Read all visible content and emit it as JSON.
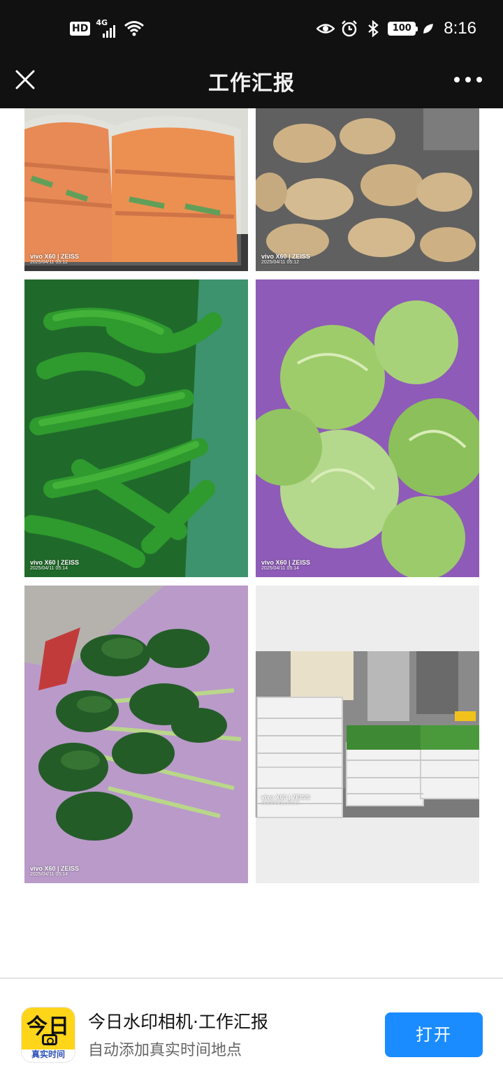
{
  "status_bar": {
    "hd": "HD",
    "network": "4G",
    "battery": "100",
    "time": "8:16",
    "icons": [
      "hd-icon",
      "signal-icon",
      "wifi-icon",
      "eye-icon",
      "alarm-icon",
      "bluetooth-icon",
      "battery-icon",
      "leaf-icon"
    ]
  },
  "nav": {
    "title": "工作汇报",
    "close_icon": "close-icon",
    "more_icon": "more-icon"
  },
  "photos": [
    {
      "subject": "carrots",
      "brand": "vivo X60 | ZEISS",
      "date": "2025/04/11 05:12"
    },
    {
      "subject": "potatoes",
      "brand": "vivo X60 | ZEISS",
      "date": "2025/04/11 05:12"
    },
    {
      "subject": "green-peppers",
      "brand": "vivo X60 | ZEISS",
      "date": "2025/04/11 05:14"
    },
    {
      "subject": "cabbage",
      "brand": "vivo X60 | ZEISS",
      "date": "2025/04/11 05:14"
    },
    {
      "subject": "spinach",
      "brand": "vivo X60 | ZEISS",
      "date": "2025/04/11 05:14"
    },
    {
      "subject": "vegetable-crates",
      "brand": "vivo X60 | ZEISS",
      "date": "2025/04/11 05:14"
    }
  ],
  "banner": {
    "icon_top": "今日",
    "icon_bottom": "真实时间",
    "app_name": "今日水印相机·工作汇报",
    "app_desc": "自动添加真实时间地点",
    "open_label": "打开",
    "accent": "#1a8cff",
    "icon_yellow": "#ffd51a"
  }
}
